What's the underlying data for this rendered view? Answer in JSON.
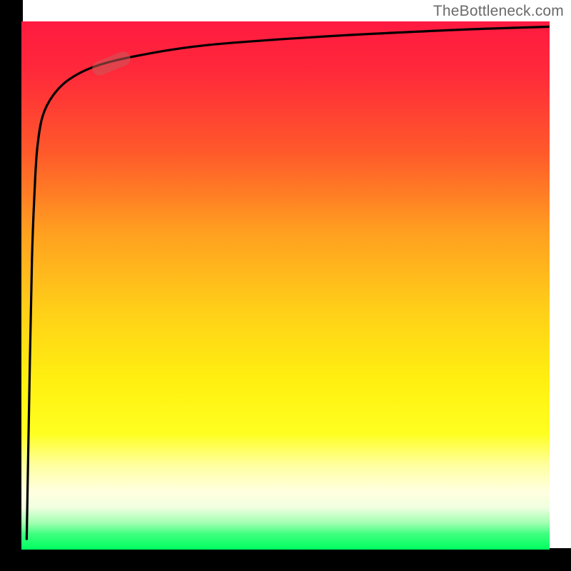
{
  "watermark": {
    "text": "TheBottleneck.com"
  },
  "colors": {
    "gradient_top": "#ff1a40",
    "gradient_mid": "#fff010",
    "gradient_bottom": "#00ff60",
    "axis": "#000000",
    "curve": "#000000",
    "marker": "rgba(200,90,90,0.55)"
  },
  "chart_data": {
    "type": "line",
    "title": "",
    "xlabel": "",
    "ylabel": "",
    "xlim": [
      0,
      100
    ],
    "ylim": [
      0,
      100
    ],
    "grid": false,
    "legend": false,
    "background_gradient": {
      "direction": "vertical",
      "stops": [
        {
          "pos": 0.0,
          "color": "#ff1a40"
        },
        {
          "pos": 0.55,
          "color": "#ffd018"
        },
        {
          "pos": 0.78,
          "color": "#ffff20"
        },
        {
          "pos": 1.0,
          "color": "#00ff60"
        }
      ]
    },
    "series": [
      {
        "name": "curve",
        "x": [
          1.0,
          1.5,
          2.0,
          2.5,
          3.0,
          4.0,
          6.0,
          9.0,
          14.0,
          22.0,
          35.0,
          55.0,
          80.0,
          100.0
        ],
        "values": [
          2.0,
          30.0,
          55.0,
          68.0,
          76.0,
          82.0,
          86.0,
          89.0,
          91.5,
          93.5,
          95.5,
          97.0,
          98.3,
          99.0
        ]
      }
    ],
    "annotations": [
      {
        "name": "marker",
        "x": 17.0,
        "y": 92.0,
        "angle_deg": -22
      }
    ]
  }
}
